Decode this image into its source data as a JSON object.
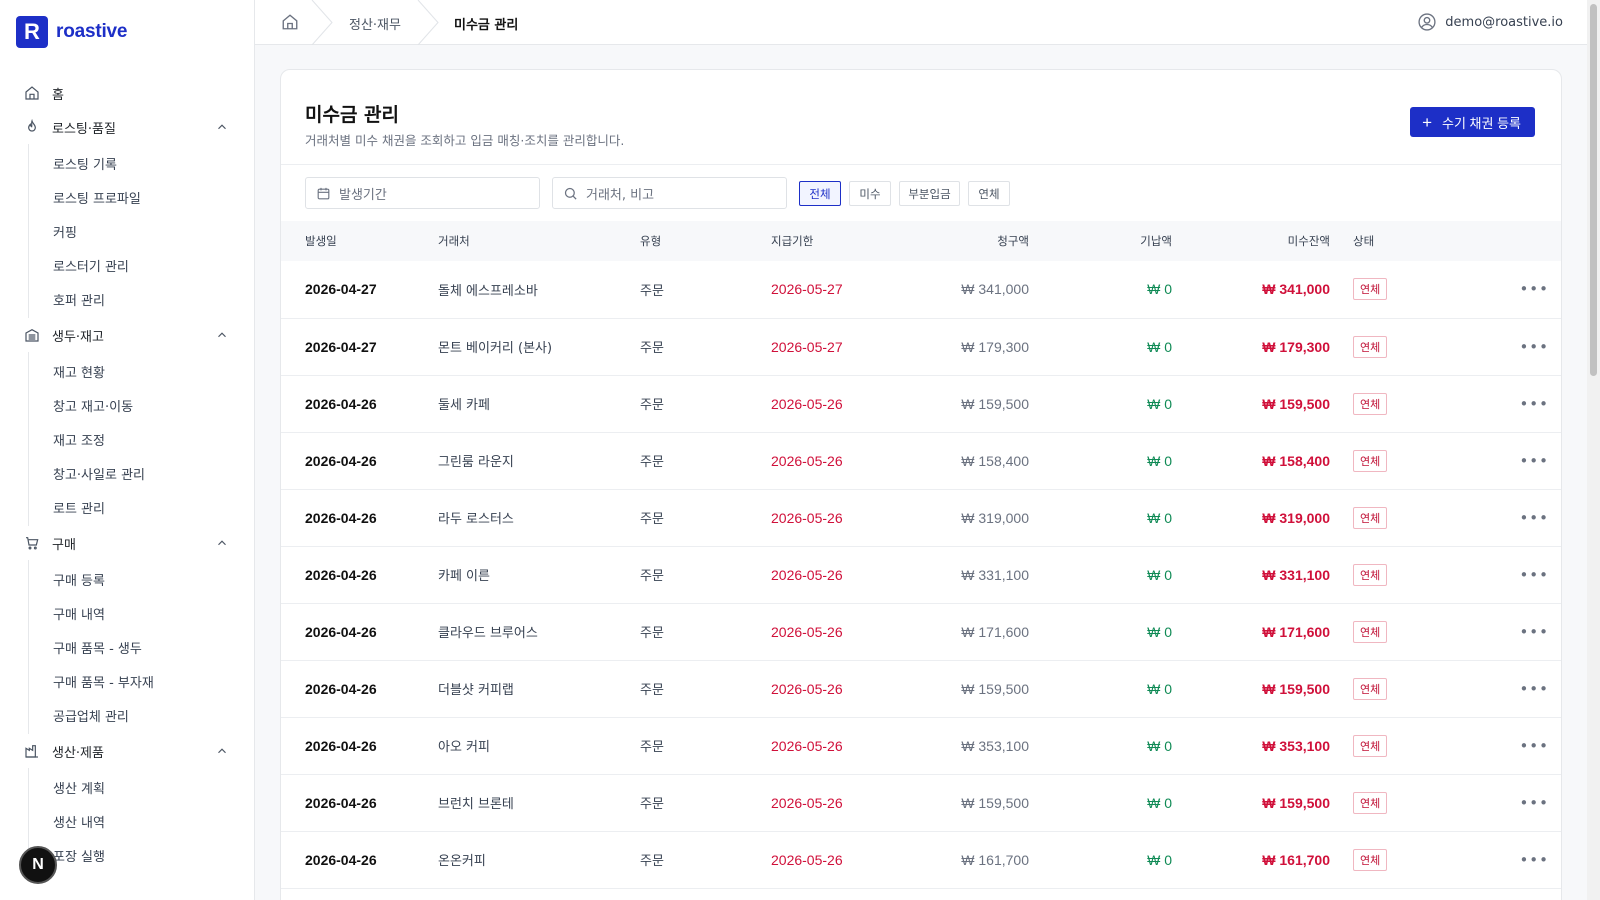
{
  "brand": {
    "logo_letter": "R",
    "name": "roastive"
  },
  "sidebar": {
    "items": [
      {
        "label": "홈",
        "icon": "home-icon",
        "sub": []
      },
      {
        "label": "로스팅·품질",
        "icon": "flame-icon",
        "sub": [
          "로스팅 기록",
          "로스팅 프로파일",
          "커핑",
          "로스터기 관리",
          "호퍼 관리"
        ]
      },
      {
        "label": "생두·재고",
        "icon": "warehouse-icon",
        "sub": [
          "재고 현황",
          "창고 재고·이동",
          "재고 조정",
          "창고·사일로 관리",
          "로트 관리"
        ]
      },
      {
        "label": "구매",
        "icon": "cart-icon",
        "sub": [
          "구매 등록",
          "구매 내역",
          "구매 품목 - 생두",
          "구매 품목 - 부자재",
          "공급업체 관리"
        ]
      },
      {
        "label": "생산·제품",
        "icon": "factory-icon",
        "sub": [
          "생산 계획",
          "생산 내역",
          "포장 실행"
        ]
      }
    ],
    "fab_letter": "N"
  },
  "topbar": {
    "breadcrumb": [
      "정산·재무",
      "미수금 관리"
    ],
    "user_email": "demo@roastive.io"
  },
  "page": {
    "title": "미수금 관리",
    "description": "거래처별 미수 채권을 조회하고 입금 매칭·조치를 관리합니다.",
    "add_button": "수기 채권 등록"
  },
  "filters": {
    "date_placeholder": "발생기간",
    "search_placeholder": "거래처, 비고",
    "chips": [
      "전체",
      "미수",
      "부분입금",
      "연체"
    ],
    "active_chip": "전체"
  },
  "table": {
    "headers": [
      "발생일",
      "거래처",
      "유형",
      "지급기한",
      "청구액",
      "기납액",
      "미수잔액",
      "상태"
    ],
    "rows": [
      {
        "date": "2026-04-27",
        "client": "돌체 에스프레소바",
        "type": "주문",
        "due": "2026-05-27",
        "claim": "₩ 341,000",
        "paid": "₩ 0",
        "balance": "₩ 341,000",
        "status": "연체"
      },
      {
        "date": "2026-04-27",
        "client": "몬트 베이커리 (본사)",
        "type": "주문",
        "due": "2026-05-27",
        "claim": "₩ 179,300",
        "paid": "₩ 0",
        "balance": "₩ 179,300",
        "status": "연체"
      },
      {
        "date": "2026-04-26",
        "client": "둘세 카페",
        "type": "주문",
        "due": "2026-05-26",
        "claim": "₩ 159,500",
        "paid": "₩ 0",
        "balance": "₩ 159,500",
        "status": "연체"
      },
      {
        "date": "2026-04-26",
        "client": "그린룸 라운지",
        "type": "주문",
        "due": "2026-05-26",
        "claim": "₩ 158,400",
        "paid": "₩ 0",
        "balance": "₩ 158,400",
        "status": "연체"
      },
      {
        "date": "2026-04-26",
        "client": "라두 로스터스",
        "type": "주문",
        "due": "2026-05-26",
        "claim": "₩ 319,000",
        "paid": "₩ 0",
        "balance": "₩ 319,000",
        "status": "연체"
      },
      {
        "date": "2026-04-26",
        "client": "카페 이른",
        "type": "주문",
        "due": "2026-05-26",
        "claim": "₩ 331,100",
        "paid": "₩ 0",
        "balance": "₩ 331,100",
        "status": "연체"
      },
      {
        "date": "2026-04-26",
        "client": "클라우드 브루어스",
        "type": "주문",
        "due": "2026-05-26",
        "claim": "₩ 171,600",
        "paid": "₩ 0",
        "balance": "₩ 171,600",
        "status": "연체"
      },
      {
        "date": "2026-04-26",
        "client": "더블샷 커피랩",
        "type": "주문",
        "due": "2026-05-26",
        "claim": "₩ 159,500",
        "paid": "₩ 0",
        "balance": "₩ 159,500",
        "status": "연체"
      },
      {
        "date": "2026-04-26",
        "client": "아오 커피",
        "type": "주문",
        "due": "2026-05-26",
        "claim": "₩ 353,100",
        "paid": "₩ 0",
        "balance": "₩ 353,100",
        "status": "연체"
      },
      {
        "date": "2026-04-26",
        "client": "브런치 브론테",
        "type": "주문",
        "due": "2026-05-26",
        "claim": "₩ 159,500",
        "paid": "₩ 0",
        "balance": "₩ 159,500",
        "status": "연체"
      },
      {
        "date": "2026-04-26",
        "client": "온온커피",
        "type": "주문",
        "due": "2026-05-26",
        "claim": "₩ 161,700",
        "paid": "₩ 0",
        "balance": "₩ 161,700",
        "status": "연체"
      }
    ]
  },
  "colors": {
    "accent": "#1d2fc7",
    "overdue": "#d0103a",
    "paid": "#0f8a55"
  }
}
